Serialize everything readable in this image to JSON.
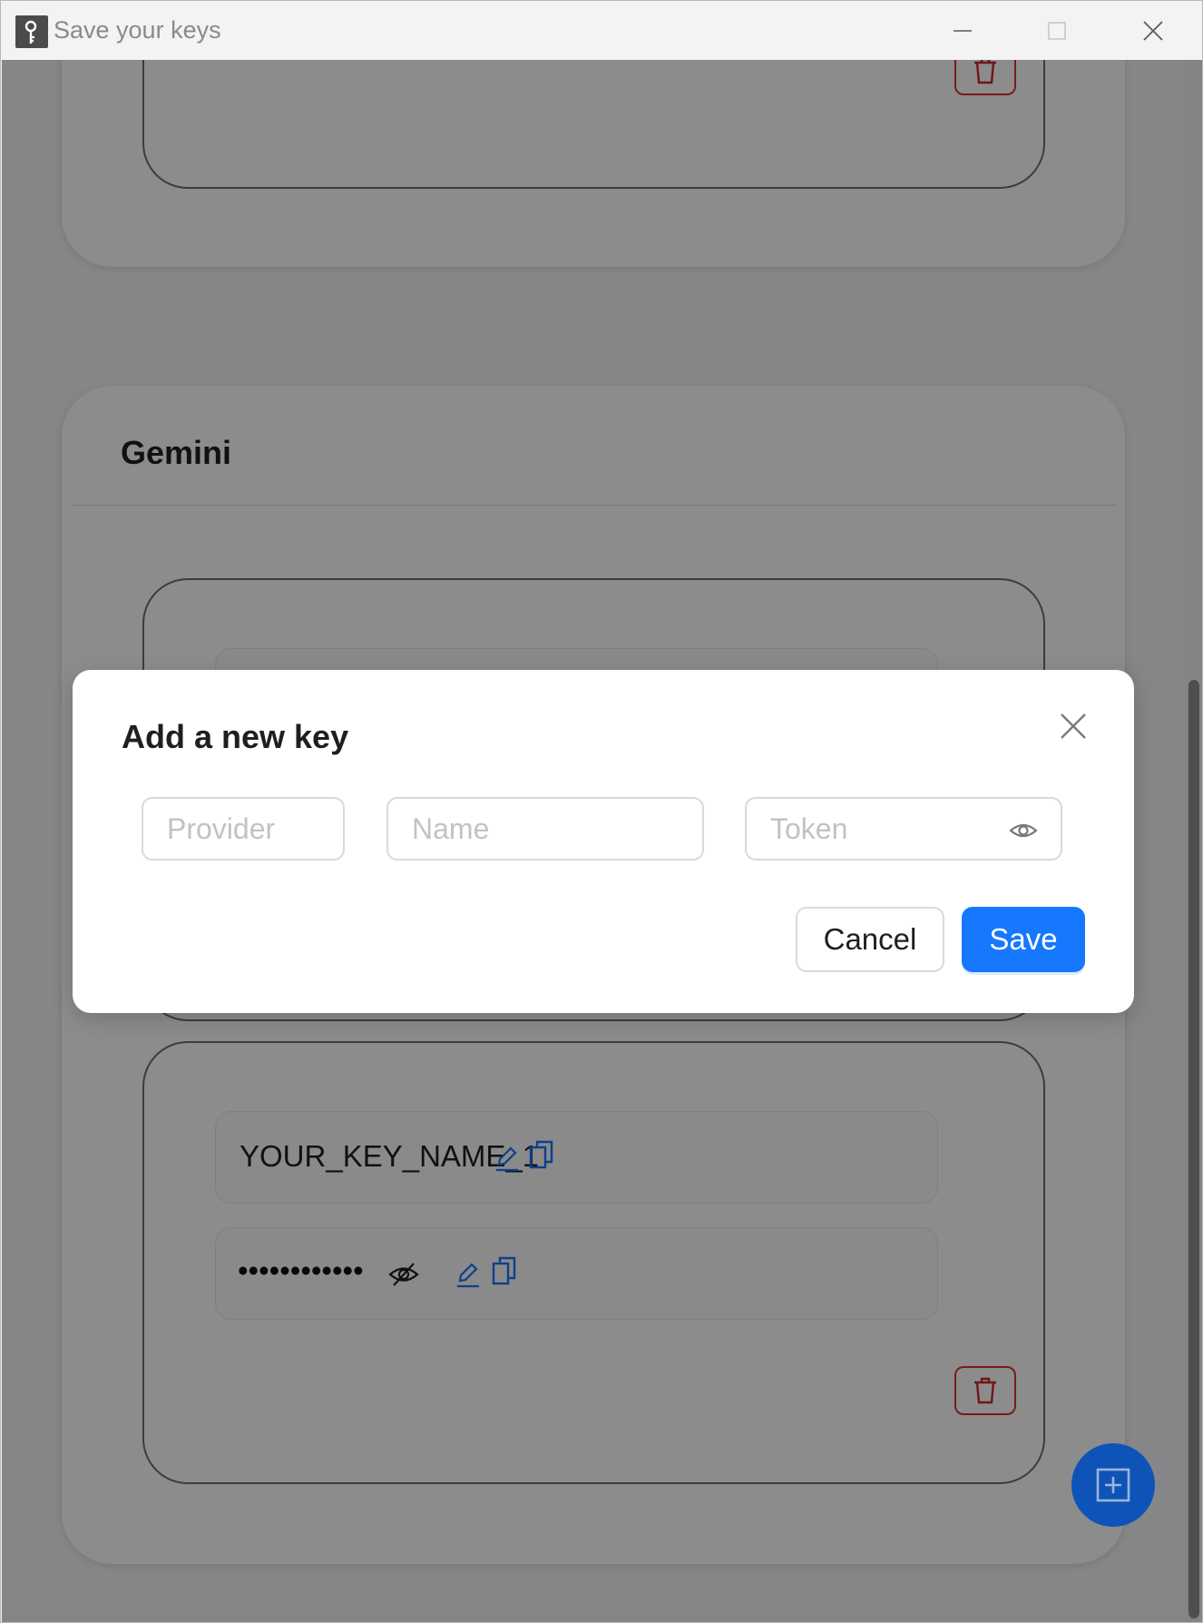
{
  "window": {
    "title": "Save your keys",
    "app_icon": "key-icon",
    "controls": [
      "minimize-icon",
      "maximize-icon",
      "close-icon"
    ]
  },
  "cards": [
    {
      "title": "",
      "keys": [
        {
          "actions": [
            "trash-icon"
          ]
        }
      ]
    },
    {
      "title": "Gemini",
      "keys": [
        {
          "name": "",
          "token": ""
        },
        {
          "name": "YOUR_KEY_NAME_1",
          "token_masked": "••••••••••••",
          "name_icons": [
            "edit-icon",
            "copy-icon"
          ],
          "token_icons": [
            "eye-slash-icon",
            "edit-icon",
            "copy-icon"
          ],
          "actions": [
            "trash-icon"
          ]
        }
      ]
    }
  ],
  "fab": {
    "icon": "plus-square-icon"
  },
  "modal": {
    "title": "Add a new key",
    "close_icon": "close-icon",
    "fields": {
      "provider": {
        "placeholder": "Provider",
        "value": ""
      },
      "name": {
        "placeholder": "Name",
        "value": ""
      },
      "token": {
        "placeholder": "Token",
        "value": "",
        "icon": "eye-icon"
      }
    },
    "cancel_label": "Cancel",
    "save_label": "Save"
  },
  "colors": {
    "primary": "#1677ff",
    "danger": "#e03131",
    "fab": "#0e54b8",
    "link": "#1677ff"
  }
}
